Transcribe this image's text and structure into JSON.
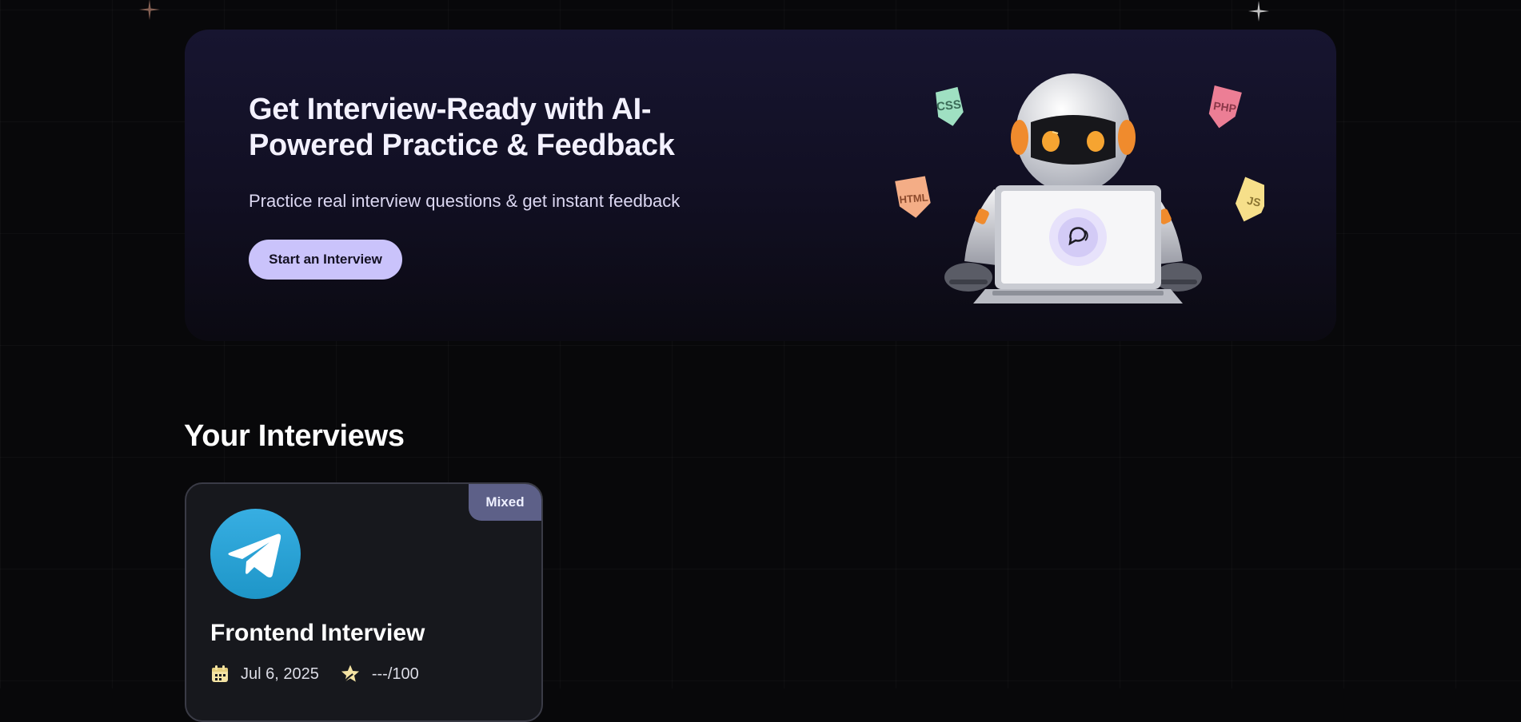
{
  "hero": {
    "title": "Get Interview-Ready with AI-Powered Practice & Feedback",
    "subtitle": "Practice real interview questions & get instant feedback",
    "cta_label": "Start an Interview",
    "badges": [
      "CSS",
      "PHP",
      "HTML",
      "JS"
    ]
  },
  "section": {
    "title": "Your Interviews"
  },
  "interviews": [
    {
      "type_badge": "Mixed",
      "title": "Frontend Interview",
      "date": "Jul 6, 2025",
      "score": "---/100",
      "logo_icon": "telegram-icon"
    }
  ],
  "icons": {
    "date": "calendar-icon",
    "score": "star-icon",
    "hero": "robot-laptop-illustration"
  },
  "colors": {
    "background": "#08080a",
    "hero_bg": "#171530",
    "cta_bg": "#cac3fb",
    "badge_bg": "#5d6088",
    "card_bg": "#17181d",
    "card_border": "#3a3b46",
    "logo_blue": "#37aee2",
    "icon_gold": "#f4e3a3"
  }
}
